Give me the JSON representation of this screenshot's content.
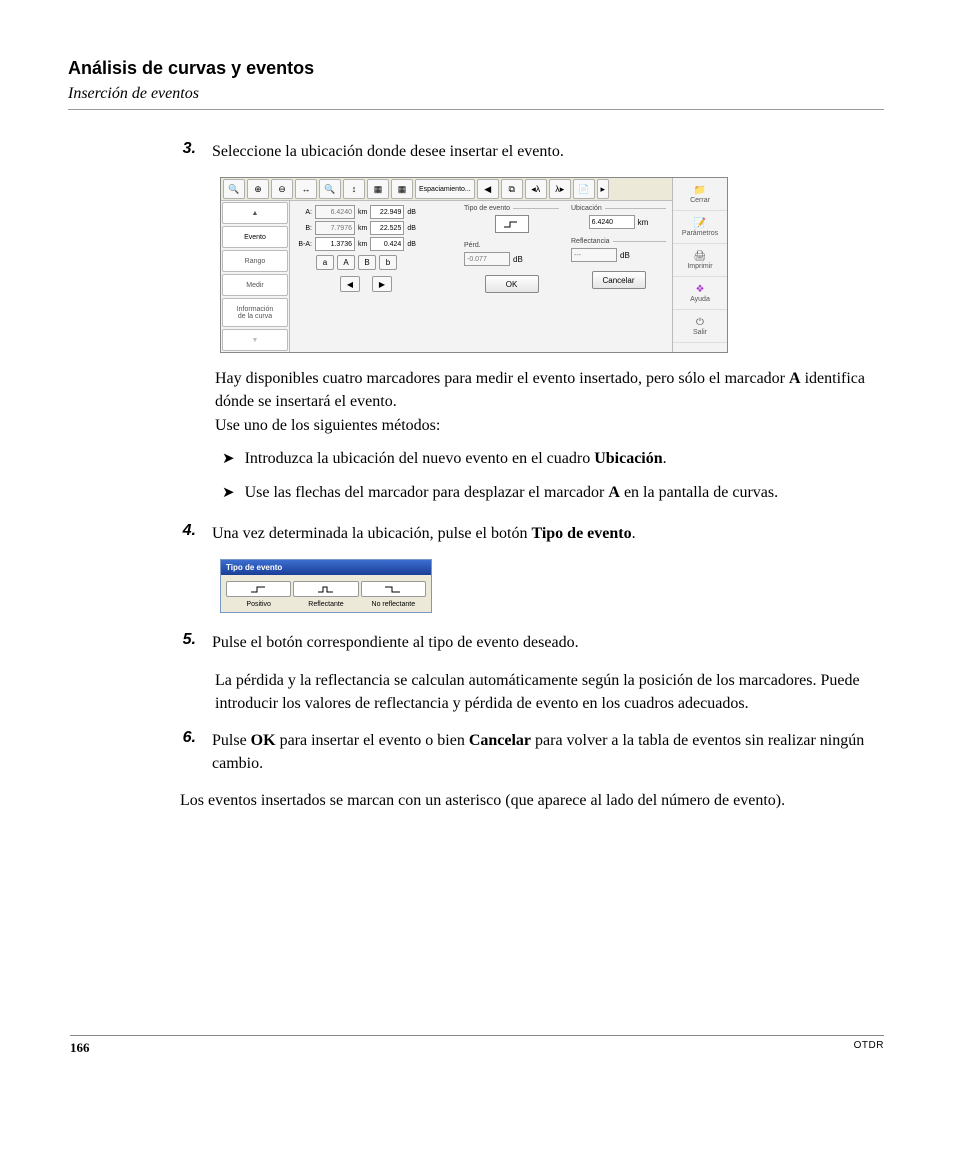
{
  "header": {
    "title": "Análisis de curvas y eventos",
    "subtitle": "Inserción de eventos"
  },
  "steps": {
    "s3": {
      "num": "3.",
      "text": "Seleccione la ubicación donde desee insertar el evento."
    },
    "s4": {
      "num": "4.",
      "text_pre": "Una vez determinada la ubicación, pulse el botón ",
      "bold": "Tipo de evento",
      "text_post": "."
    },
    "s5": {
      "num": "5.",
      "text": "Pulse el botón correspondiente al tipo de evento deseado."
    },
    "s6": {
      "num": "6.",
      "pre": "Pulse ",
      "b1": "OK",
      "mid": " para insertar el evento o bien ",
      "b2": "Cancelar",
      "post": " para volver a la tabla de eventos sin realizar ningún cambio."
    }
  },
  "paras": {
    "p1a": "Hay disponibles cuatro marcadores para medir el evento insertado, pero sólo el marcador ",
    "p1b": "A",
    "p1c": " identifica dónde se insertará el evento.",
    "p2": "Use uno de los siguientes métodos:",
    "p5b": "La pérdida y la reflectancia se calculan automáticamente según la posición de los marcadores. Puede introducir los valores de reflectancia y pérdida de evento en los cuadros adecuados.",
    "pEnd": "Los eventos insertados se marcan con un asterisco (que aparece al lado del número de evento)."
  },
  "bullets": {
    "b1": {
      "pre": "Introduzca la ubicación del nuevo evento en el cuadro ",
      "bold": "Ubicación",
      "post": "."
    },
    "b2": {
      "pre": "Use las flechas del marcador para desplazar el marcador ",
      "bold": "A",
      "post": " en la pantalla de curvas."
    }
  },
  "shot1": {
    "toolbar": {
      "spacing": "Espaciamiento..."
    },
    "tabs": {
      "evento": "Evento",
      "rango": "Rango",
      "medir": "Medir",
      "info1": "Información",
      "info2": "de la curva"
    },
    "markers": {
      "A": {
        "label": "A:",
        "dist": "6.4240",
        "unit": "km",
        "loss": "22.949",
        "lunit": "dB"
      },
      "B": {
        "label": "B:",
        "dist": "7.7976",
        "unit": "km",
        "loss": "22.525",
        "lunit": "dB"
      },
      "BA": {
        "label": "B-A:",
        "dist": "1.3736",
        "unit": "km",
        "loss": "0.424",
        "lunit": "dB"
      },
      "btns": {
        "a": "a",
        "Acap": "A",
        "Bcap": "B",
        "b": "b"
      }
    },
    "form": {
      "tipo": "Tipo de evento",
      "ubic": "Ubicación",
      "ubicval": "6.4240",
      "ubicunit": "km",
      "perd": "Pérd.",
      "perdval": "-0.077",
      "perdunit": "dB",
      "refl": "Reflectancia",
      "reflval": "---",
      "reflunit": "dB",
      "ok": "OK",
      "cancel": "Cancelar"
    },
    "sidebar": {
      "cerrar": "Cerrar",
      "params": "Parámetros",
      "imprimir": "Imprimir",
      "ayuda": "Ayuda",
      "salir": "Salir"
    }
  },
  "shot2": {
    "title": "Tipo de evento",
    "pos": "Positivo",
    "refl": "Reflectante",
    "norefl": "No reflectante"
  },
  "footer": {
    "page": "166",
    "product": "OTDR"
  }
}
